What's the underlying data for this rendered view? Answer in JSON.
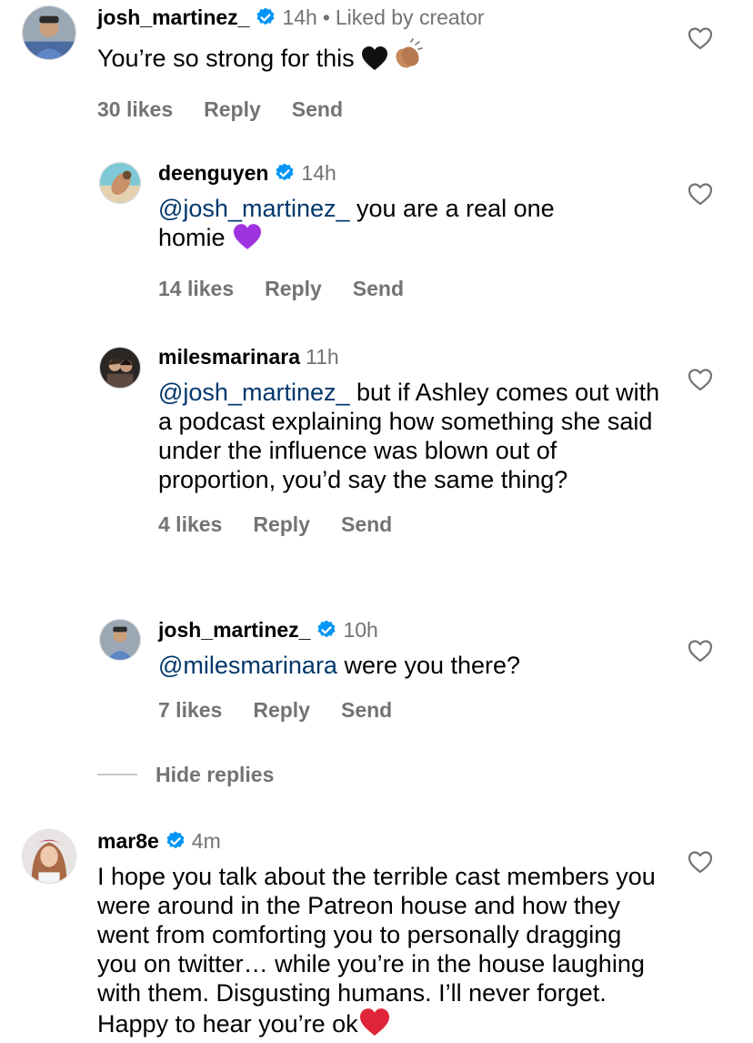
{
  "comments": [
    {
      "username": "josh_martinez_",
      "verified": true,
      "time": "14h",
      "extra": "Liked by creator",
      "text_plain": "You’re so strong for this ",
      "likes": "30 likes",
      "reply": "Reply",
      "send": "Send",
      "avatar_icon": "person-avatar"
    },
    {
      "username": "deenguyen",
      "verified": true,
      "time": "14h",
      "mention": "@josh_martinez_",
      "text_plain": " you are a real one homie ",
      "likes": "14 likes",
      "reply": "Reply",
      "send": "Send",
      "avatar_icon": "beach-avatar"
    },
    {
      "username": "milesmarinara",
      "verified": false,
      "time": "11h",
      "mention": "@josh_martinez_",
      "text_plain": " but if Ashley comes out with a podcast explaining how something she said under the influence was blown out of proportion, you’d say the same thing?",
      "likes": "4 likes",
      "reply": "Reply",
      "send": "Send",
      "avatar_icon": "dark-photo-avatar"
    },
    {
      "username": "josh_martinez_",
      "verified": true,
      "time": "10h",
      "mention": "@milesmarinara",
      "text_plain": " were you there?",
      "likes": "7 likes",
      "reply": "Reply",
      "send": "Send",
      "avatar_icon": "person-avatar"
    },
    {
      "username": "mar8e",
      "verified": true,
      "time": "4m",
      "text_plain": "I hope you talk about the terrible cast members you were around in the Patreon house and how they went from comforting you to personally dragging you on twitter… while you’re in the house laughing with them. Disgusting humans. I’ll never forget. Happy to hear you’re ok",
      "avatar_icon": "woman-avatar"
    }
  ],
  "hide_replies_label": "Hide replies",
  "colors": {
    "secondary_text": "#737373",
    "mention": "#00376b",
    "verified_blue": "#0095f6"
  }
}
